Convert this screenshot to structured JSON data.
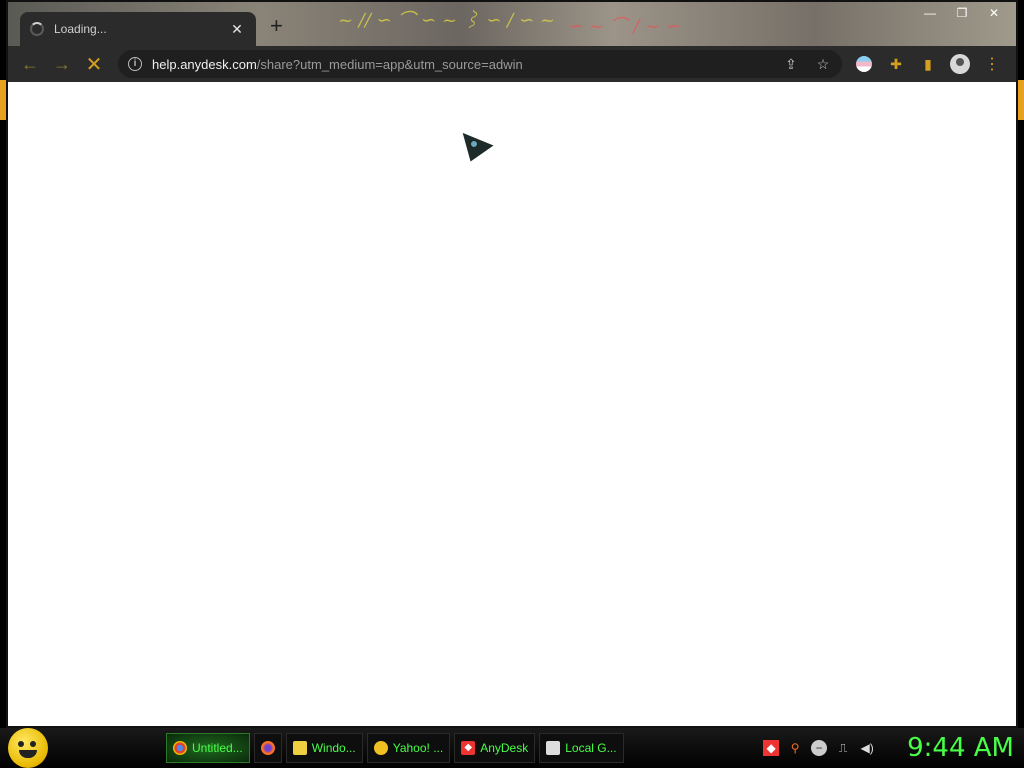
{
  "browser": {
    "tab": {
      "title": "Loading...",
      "close_glyph": "✕"
    },
    "new_tab_glyph": "+",
    "window_controls": [
      "minimize-icon",
      "restore-icon",
      "close-icon"
    ],
    "toolbar": {
      "back_icon": "back-arrow-icon",
      "forward_icon": "forward-arrow-icon",
      "reload_icon": "stop-loading-icon",
      "url_host": "help.anydesk.com",
      "url_path": "/share?utm_medium=app&utm_source=adwin",
      "info_icon": "site-info-icon",
      "share_icon": "share-icon",
      "bookmark_icon": "star-icon",
      "extension_icons": [
        "extension-disc-icon",
        "puzzle-icon",
        "side-panel-icon"
      ],
      "profile_icon": "profile-icon",
      "menu_icon": "kebab-menu-icon"
    },
    "accent_color": "#d4a020"
  },
  "taskbar": {
    "tasks": [
      {
        "label": "Untitled...",
        "icon": "chrome-icon",
        "active": true
      },
      {
        "label": "",
        "icon": "firefox-icon",
        "active": false
      },
      {
        "label": "Windo...",
        "icon": "folder-icon",
        "active": false
      },
      {
        "label": "Yahoo! ...",
        "icon": "yahoo-smiley-icon",
        "active": false
      },
      {
        "label": "AnyDesk",
        "icon": "anydesk-icon",
        "active": false
      },
      {
        "label": "Local G...",
        "icon": "document-icon",
        "active": false
      }
    ],
    "tray_icons": [
      "anydesk-tray-icon",
      "search-tray-icon",
      "status-tray-icon",
      "network-icon",
      "volume-icon"
    ],
    "clock": "9:44 AM",
    "clock_color": "#48ff48"
  }
}
